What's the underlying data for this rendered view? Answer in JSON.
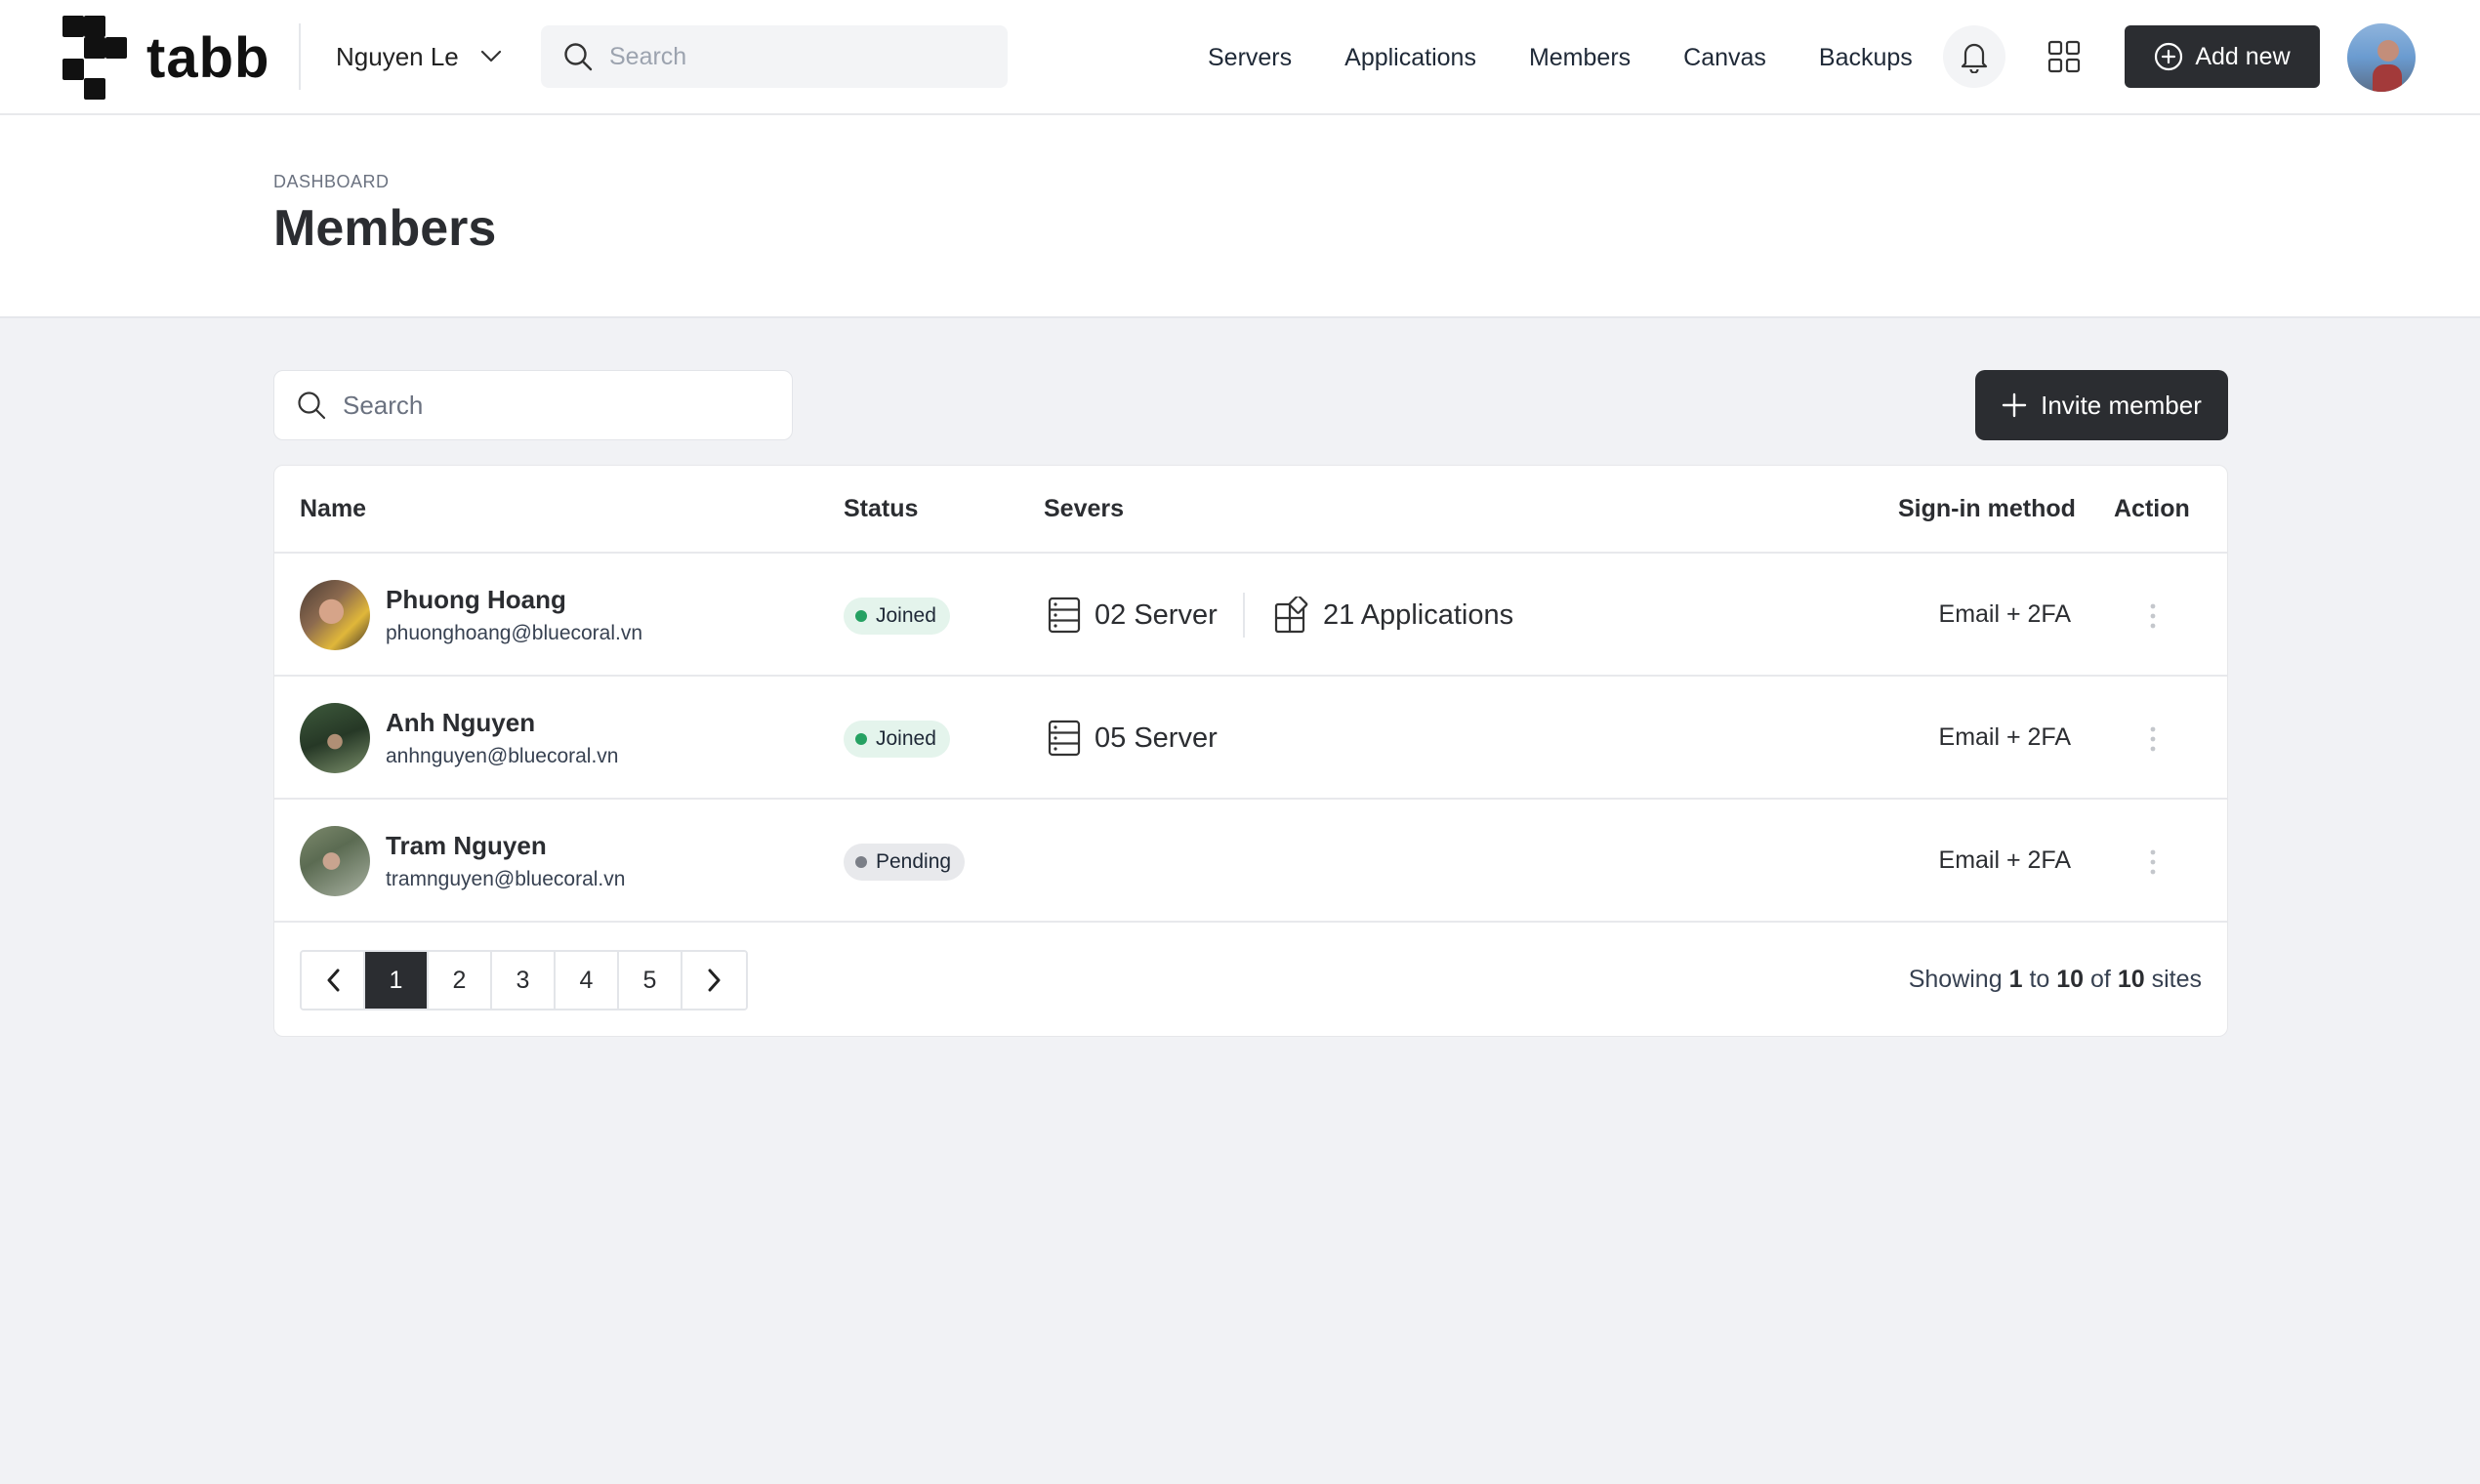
{
  "header": {
    "brand": "tabb",
    "workspace": "Nguyen Le",
    "search_placeholder": "Search",
    "nav": [
      "Servers",
      "Applications",
      "Members",
      "Canvas",
      "Backups"
    ],
    "add_new": "Add new"
  },
  "page": {
    "breadcrumb": "DASHBOARD",
    "title": "Members"
  },
  "controls": {
    "search_placeholder": "Search",
    "invite": "Invite member"
  },
  "table": {
    "columns": {
      "name": "Name",
      "status": "Status",
      "servers": "Severs",
      "signin": "Sign-in method",
      "action": "Action"
    },
    "rows": [
      {
        "name": "Phuong Hoang",
        "email": "phuonghoang@bluecoral.vn",
        "status": "Joined",
        "servers": "02 Server",
        "applications": "21 Applications",
        "signin": "Email + 2FA"
      },
      {
        "name": "Anh Nguyen",
        "email": "anhnguyen@bluecoral.vn",
        "status": "Joined",
        "servers": "05 Server",
        "signin": "Email + 2FA"
      },
      {
        "name": "Tram Nguyen",
        "email": "tramnguyen@bluecoral.vn",
        "status": "Pending",
        "signin": "Email + 2FA"
      }
    ]
  },
  "pagination": {
    "pages": [
      "1",
      "2",
      "3",
      "4",
      "5"
    ],
    "current": "1",
    "showing_prefix": "Showing",
    "from": "1",
    "to_word": "to",
    "to": "10",
    "of_word": "of",
    "total": "10",
    "suffix": "sites"
  },
  "colors": {
    "primary_dark": "#2b2d31",
    "joined_badge_bg": "#e4f4ec",
    "joined_dot": "#25a162",
    "pending_badge_bg": "#e8e9ec",
    "pending_dot": "#7b7f87",
    "page_bg": "#f1f2f5"
  }
}
